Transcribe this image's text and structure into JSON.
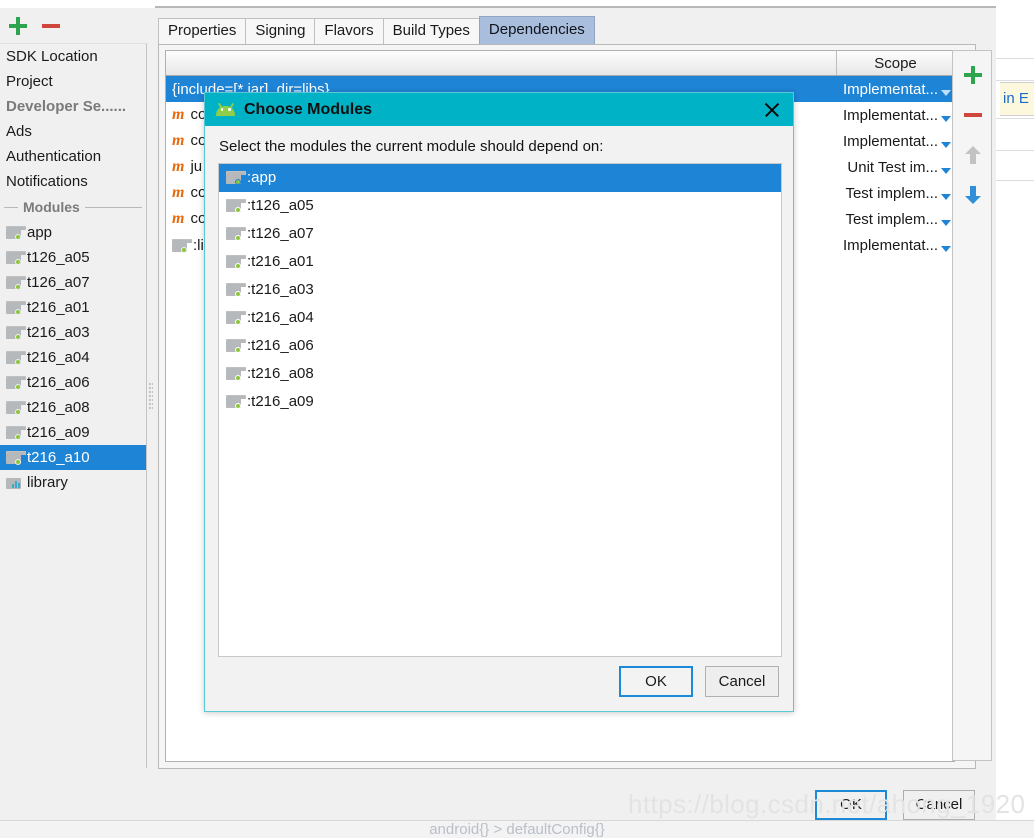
{
  "window": {
    "ok_label": "OK",
    "cancel_label": "Cancel",
    "breadcrumb": "android{}  >  defaultConfig{}",
    "watermark": "https://blog.csdn.net/ahong_1920"
  },
  "sidebar": {
    "add_icon": "plus-icon",
    "remove_icon": "minus-icon",
    "top_items": [
      {
        "label": "SDK Location",
        "selected": false
      },
      {
        "label": "Project",
        "selected": false
      }
    ],
    "section_header": "Developer Se......",
    "service_items": [
      {
        "label": "Ads",
        "selected": false
      },
      {
        "label": "Authentication",
        "selected": false
      },
      {
        "label": "Notifications",
        "selected": false
      }
    ],
    "modules_separator": "Modules",
    "modules": [
      {
        "label": "app",
        "icon": "module-icon",
        "selected": false
      },
      {
        "label": "t126_a05",
        "icon": "module-icon",
        "selected": false
      },
      {
        "label": "t126_a07",
        "icon": "module-icon",
        "selected": false
      },
      {
        "label": "t216_a01",
        "icon": "module-icon",
        "selected": false
      },
      {
        "label": "t216_a03",
        "icon": "module-icon",
        "selected": false
      },
      {
        "label": "t216_a04",
        "icon": "module-icon",
        "selected": false
      },
      {
        "label": "t216_a06",
        "icon": "module-icon",
        "selected": false
      },
      {
        "label": "t216_a08",
        "icon": "module-icon",
        "selected": false
      },
      {
        "label": "t216_a09",
        "icon": "module-icon",
        "selected": false
      },
      {
        "label": "t216_a10",
        "icon": "module-icon",
        "selected": true
      },
      {
        "label": "library",
        "icon": "library-icon",
        "selected": false
      }
    ]
  },
  "tabs": [
    {
      "label": "Properties",
      "active": false
    },
    {
      "label": "Signing",
      "active": false
    },
    {
      "label": "Flavors",
      "active": false
    },
    {
      "label": "Build Types",
      "active": false
    },
    {
      "label": "Dependencies",
      "active": true
    }
  ],
  "table": {
    "headers": {
      "name": "",
      "scope": "Scope"
    },
    "rows": [
      {
        "kind": "file",
        "name": "{include=[*.jar], dir=libs}",
        "scope": "Implementat...",
        "selected": true
      },
      {
        "kind": "m",
        "name": "co",
        "scope": "Implementat...",
        "selected": false
      },
      {
        "kind": "m",
        "name": "co",
        "scope": "Implementat...",
        "selected": false
      },
      {
        "kind": "m",
        "name": "ju",
        "scope": "Unit Test im...",
        "selected": false
      },
      {
        "kind": "m",
        "name": "co",
        "scope": "Test implem...",
        "selected": false
      },
      {
        "kind": "m",
        "name": "co",
        "scope": "Test implem...",
        "selected": false
      },
      {
        "kind": "module",
        "name": ":li",
        "scope": "Implementat...",
        "selected": false
      }
    ]
  },
  "side_buttons": [
    {
      "name": "add-dependency-button",
      "icon": "plus-icon"
    },
    {
      "name": "remove-dependency-button",
      "icon": "minus-icon"
    },
    {
      "name": "move-up-button",
      "icon": "arrow-up-icon"
    },
    {
      "name": "move-down-button",
      "icon": "arrow-down-icon"
    }
  ],
  "edge_banner": {
    "text": "in E"
  },
  "dialog": {
    "title": "Choose Modules",
    "title_icon": "android-icon",
    "close_icon": "close-icon",
    "prompt": "Select the modules the current module should depend on:",
    "items": [
      {
        "label": ":app",
        "selected": true
      },
      {
        "label": ":t126_a05",
        "selected": false
      },
      {
        "label": ":t126_a07",
        "selected": false
      },
      {
        "label": ":t216_a01",
        "selected": false
      },
      {
        "label": ":t216_a03",
        "selected": false
      },
      {
        "label": ":t216_a04",
        "selected": false
      },
      {
        "label": ":t216_a06",
        "selected": false
      },
      {
        "label": ":t216_a08",
        "selected": false
      },
      {
        "label": ":t216_a09",
        "selected": false
      }
    ],
    "ok_label": "OK",
    "cancel_label": "Cancel"
  },
  "colors": {
    "selection_blue": "#1e84d6",
    "dialog_titlebar": "#00b2c6",
    "accent_green": "#2ea44f",
    "accent_red": "#d0453c",
    "active_tab": "#a9bedd"
  }
}
